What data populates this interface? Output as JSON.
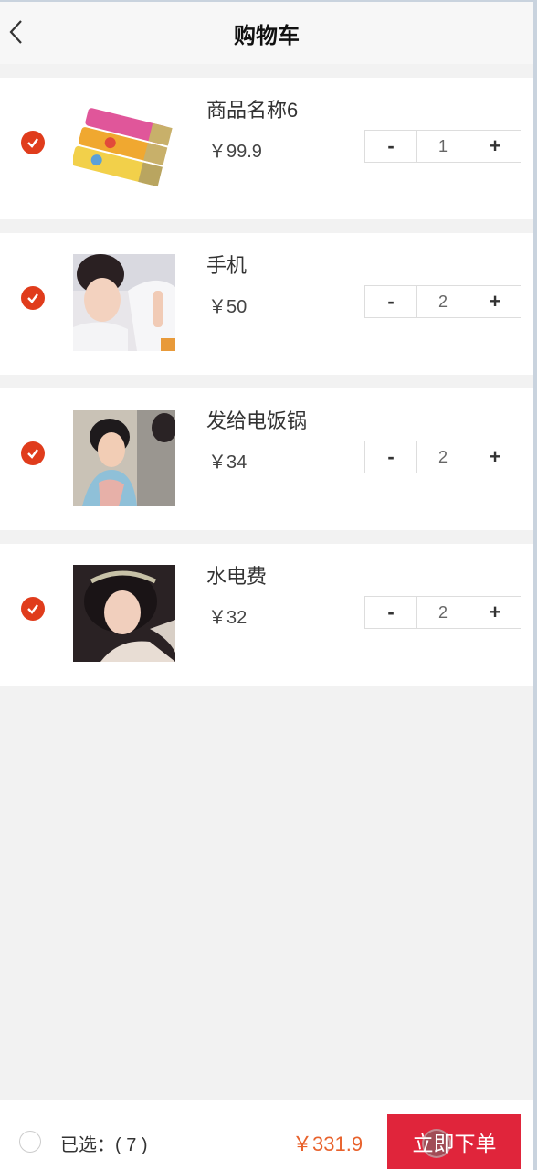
{
  "header": {
    "title": "购物车",
    "back_icon": "chevron-left-icon"
  },
  "items": [
    {
      "name": "商品名称6",
      "price": "￥99.9",
      "qty": "1",
      "checked": true,
      "thumb": "candy-sticks"
    },
    {
      "name": "手机",
      "price": "￥50",
      "qty": "2",
      "checked": true,
      "thumb": "portrait-white-robe"
    },
    {
      "name": "发给电饭锅",
      "price": "￥34",
      "qty": "2",
      "checked": true,
      "thumb": "portrait-blue-costume"
    },
    {
      "name": "水电费",
      "price": "￥32",
      "qty": "2",
      "checked": true,
      "thumb": "portrait-headdress"
    }
  ],
  "stepper": {
    "minus": "-",
    "plus": "+"
  },
  "footer": {
    "selected_label": "已选：( 7 )",
    "total": "￥331.9",
    "order_button": "立即下单"
  },
  "colors": {
    "accent": "#e03c1c",
    "total": "#e8622c",
    "order_button": "#e0253b"
  }
}
